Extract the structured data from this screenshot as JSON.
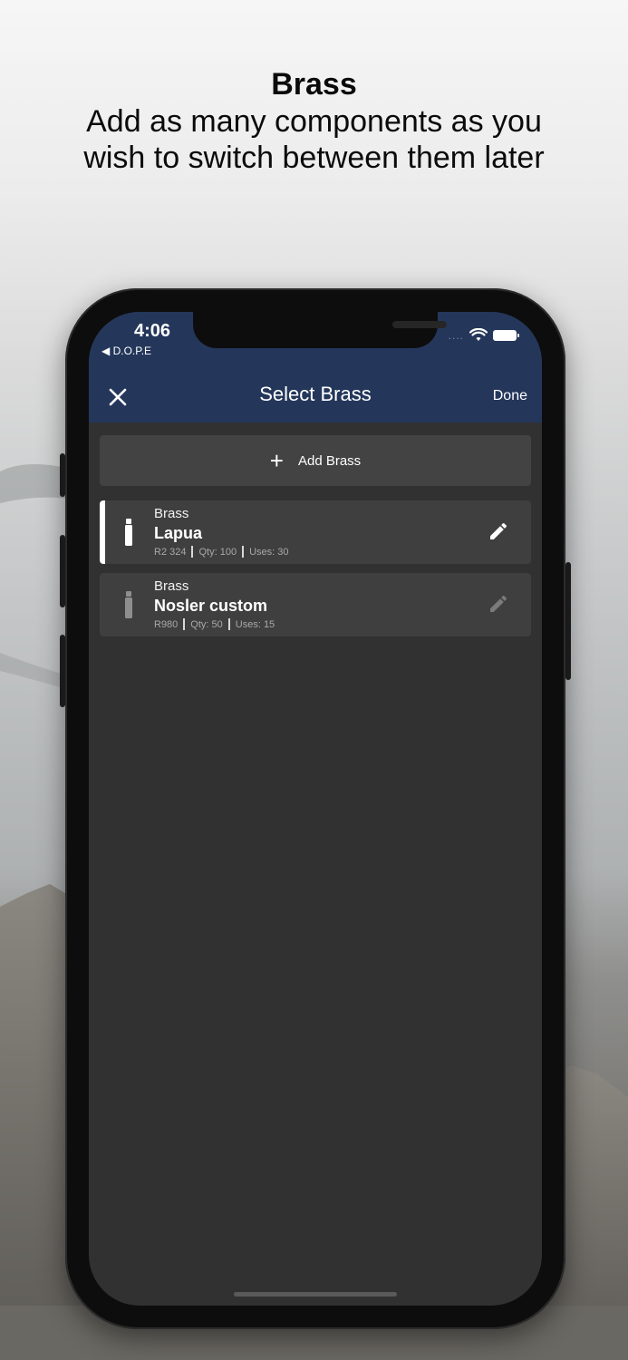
{
  "headline": {
    "title": "Brass",
    "subtitle_line1": "Add as many components as you",
    "subtitle_line2": "wish to switch between them later"
  },
  "status_bar": {
    "time": "4:06",
    "back_app": "◀ D.O.P.E",
    "signal_dots": "....",
    "icons": [
      "wifi-icon",
      "battery-icon"
    ]
  },
  "nav": {
    "close_icon": "close-icon",
    "title": "Select Brass",
    "done_label": "Done"
  },
  "add_button": {
    "label": "Add Brass",
    "icon": "+"
  },
  "items": [
    {
      "category": "Brass",
      "name": "Lapua",
      "meta": [
        "R2 324",
        "Qty: 100",
        "Uses: 30"
      ],
      "selected": true
    },
    {
      "category": "Brass",
      "name": "Nosler custom",
      "meta": [
        "R980",
        "Qty: 50",
        "Uses: 15"
      ],
      "selected": false
    }
  ],
  "colors": {
    "header": "#24375b",
    "screen_bg": "#313131",
    "card_bg": "#3f3f3f",
    "accent": "#ffffff"
  }
}
